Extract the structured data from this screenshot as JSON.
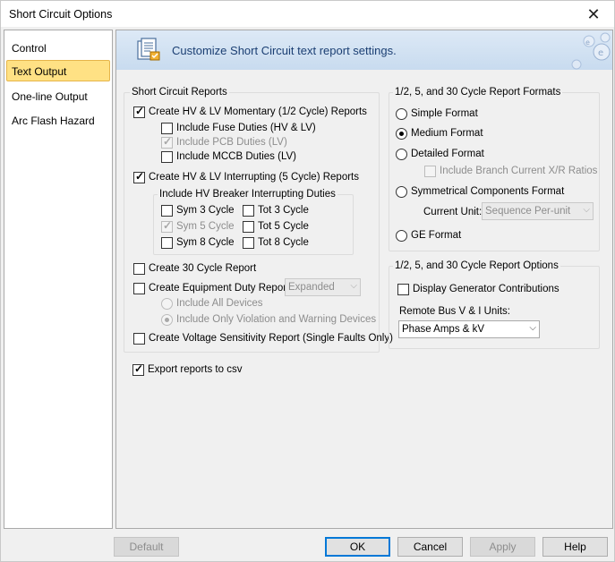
{
  "window": {
    "title": "Short Circuit Options",
    "close_glyph": "✕"
  },
  "sidebar": {
    "items": [
      "Control",
      "Text Output",
      "One-line Output",
      "Arc Flash Hazard"
    ],
    "selected": "Text Output"
  },
  "banner": {
    "text": "Customize Short Circuit text report settings."
  },
  "sc_reports": {
    "legend": "Short Circuit Reports",
    "momentary": "Create HV & LV Momentary (1/2 Cycle) Reports",
    "fuse": "Include Fuse Duties (HV & LV)",
    "pcb": "Include PCB Duties (LV)",
    "mccb": "Include MCCB Duties (LV)",
    "interrupting": "Create HV & LV Interrupting (5 Cycle) Reports",
    "breaker_legend": "Include HV Breaker Interrupting Duties",
    "sym3": "Sym 3 Cycle",
    "tot3": "Tot 3 Cycle",
    "sym5": "Sym 5 Cycle",
    "tot5": "Tot 5 Cycle",
    "sym8": "Sym 8 Cycle",
    "tot8": "Tot 8 Cycle",
    "cycle30": "Create 30 Cycle Report",
    "equip_duty": "Create Equipment Duty Report:",
    "equip_duty_value": "Expanded",
    "all_devices": "Include All Devices",
    "violation_only": "Include Only Violation and Warning Devices",
    "voltage_sens": "Create Voltage Sensitivity Report (Single Faults Only)"
  },
  "export_csv": "Export reports to csv",
  "formats": {
    "legend": "1/2, 5, and 30 Cycle Report Formats",
    "simple": "Simple Format",
    "medium": "Medium Format",
    "detailed": "Detailed Format",
    "branch_xr": "Include Branch Current X/R Ratios",
    "symmetrical": "Symmetrical Components Format",
    "current_unit_label": "Current Unit:",
    "current_unit_value": "Sequence Per-unit",
    "ge": "GE Format"
  },
  "options": {
    "legend": "1/2, 5, and 30 Cycle Report Options",
    "gen_contrib": "Display Generator Contributions",
    "remote_label": "Remote Bus V & I Units:",
    "remote_value": "Phase Amps & kV"
  },
  "buttons": {
    "default": "Default",
    "ok": "OK",
    "cancel": "Cancel",
    "apply": "Apply",
    "help": "Help"
  },
  "colors": {
    "selected_item": "#ffe184",
    "banner_text": "#1b3f73",
    "default_button_border": "#0078d7"
  }
}
